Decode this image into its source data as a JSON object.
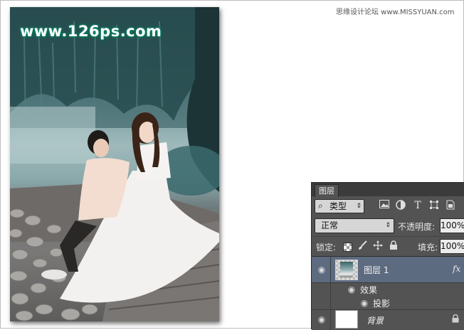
{
  "site_credit": "思缘设计论坛 www.MISSYUAN.com",
  "watermark": "www.126ps.com",
  "layers_panel": {
    "tab": "图层",
    "filter": {
      "icon": "search-icon",
      "label": "类型"
    },
    "filter_icons": [
      "image-filter-icon",
      "adjustment-filter-icon",
      "type-filter-icon",
      "shape-filter-icon",
      "smart-object-filter-icon"
    ],
    "type_glyph": "T",
    "blend_mode": "正常",
    "opacity_label": "不透明度:",
    "opacity": "100%",
    "lock_label": "锁定:",
    "fill_label": "填充:",
    "fill": "100%",
    "layers": [
      {
        "name": "图层 1",
        "fx": "fx",
        "selected": true
      },
      {
        "name": "背景",
        "locked": true
      }
    ],
    "effects_label": "效果",
    "drop_shadow_label": "投影"
  }
}
